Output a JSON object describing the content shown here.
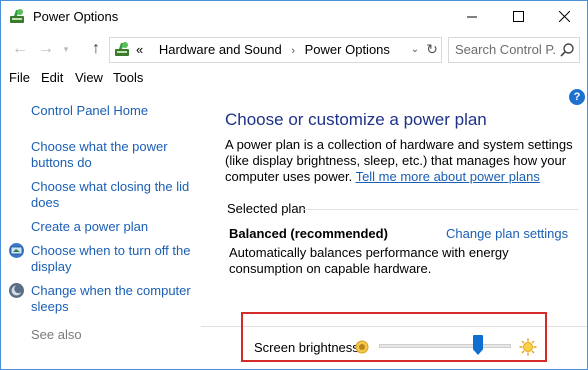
{
  "window": {
    "title": "Power Options"
  },
  "address": {
    "crumb_prefix": "«",
    "crumbs": [
      "Hardware and Sound",
      "Power Options"
    ],
    "separator": "›",
    "search_placeholder": "Search Control P..."
  },
  "menu": [
    "File",
    "Edit",
    "View",
    "Tools"
  ],
  "sidebar": {
    "links": [
      "Control Panel Home",
      "Choose what the power buttons do",
      "Choose what closing the lid does",
      "Create a power plan",
      "Choose when to turn off the display",
      "Change when the computer sleeps"
    ],
    "see_also": "See also"
  },
  "main": {
    "heading": "Choose or customize a power plan",
    "description": "A power plan is a collection of hardware and system settings (like display brightness, sleep, etc.) that manages how your computer uses power. ",
    "learn_more": "Tell me more about power plans",
    "selected_plan_label": "Selected plan",
    "plan_name": "Balanced (recommended)",
    "change_plan_link": "Change plan settings",
    "plan_description": "Automatically balances performance with energy consumption on capable hardware."
  },
  "brightness": {
    "label": "Screen brightness:",
    "level_percent": 75
  },
  "colors": {
    "link": "#1a5fb4",
    "heading": "#1e3287",
    "highlight_border": "#d42a2a",
    "slider_thumb": "#0f6fd0"
  },
  "icons": [
    "power-options-icon",
    "back-icon",
    "forward-icon",
    "recent-locations-icon",
    "up-icon",
    "refresh-icon",
    "search-icon",
    "help-icon",
    "display-icon",
    "moon-sleep-icon",
    "dim-sun-icon",
    "bright-sun-icon"
  ]
}
